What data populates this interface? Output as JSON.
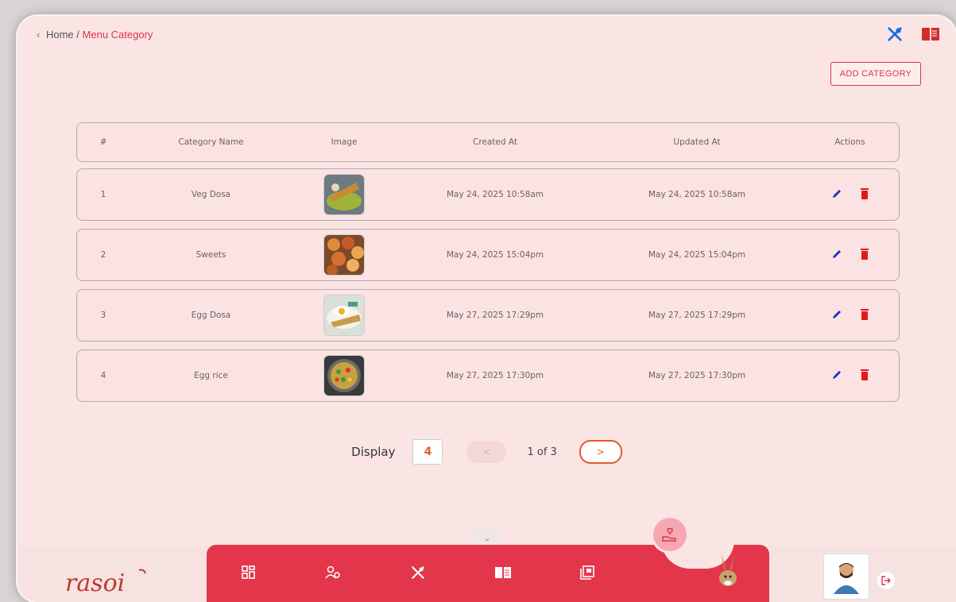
{
  "breadcrumb": {
    "back": "‹",
    "home": "Home",
    "separator": "/",
    "current": "Menu Category"
  },
  "header_icons": [
    "fork-knife-icon",
    "book-icon"
  ],
  "add_button": "ADD CATEGORY",
  "table": {
    "columns": [
      "#",
      "Category Name",
      "Image",
      "Created At",
      "Updated At",
      "Actions"
    ],
    "rows": [
      {
        "num": "1",
        "name": "Veg Dosa",
        "created": "May 24, 2025 10:58am",
        "updated": "May 24, 2025 10:58am"
      },
      {
        "num": "2",
        "name": "Sweets",
        "created": "May 24, 2025 15:04pm",
        "updated": "May 24, 2025 15:04pm"
      },
      {
        "num": "3",
        "name": "Egg Dosa",
        "created": "May 27, 2025 17:29pm",
        "updated": "May 27, 2025 17:29pm"
      },
      {
        "num": "4",
        "name": "Egg rice",
        "created": "May 27, 2025 17:30pm",
        "updated": "May 27, 2025 17:30pm"
      }
    ]
  },
  "pagination": {
    "label": "Display",
    "page_size": "4",
    "prev": "<",
    "status": "1 of 3",
    "next": ">"
  },
  "brand": {
    "logo_text": "rasoi"
  },
  "nav_icons": [
    "dashboard-icon",
    "users-settings-icon",
    "fork-knife-icon",
    "book-icon",
    "gallery-icon",
    "donate-hand-icon"
  ],
  "colors": {
    "accent": "#e3364a",
    "background": "#fbe4e4",
    "edit": "#1d2fbf",
    "delete": "#e01919",
    "next": "#e35a2a"
  }
}
